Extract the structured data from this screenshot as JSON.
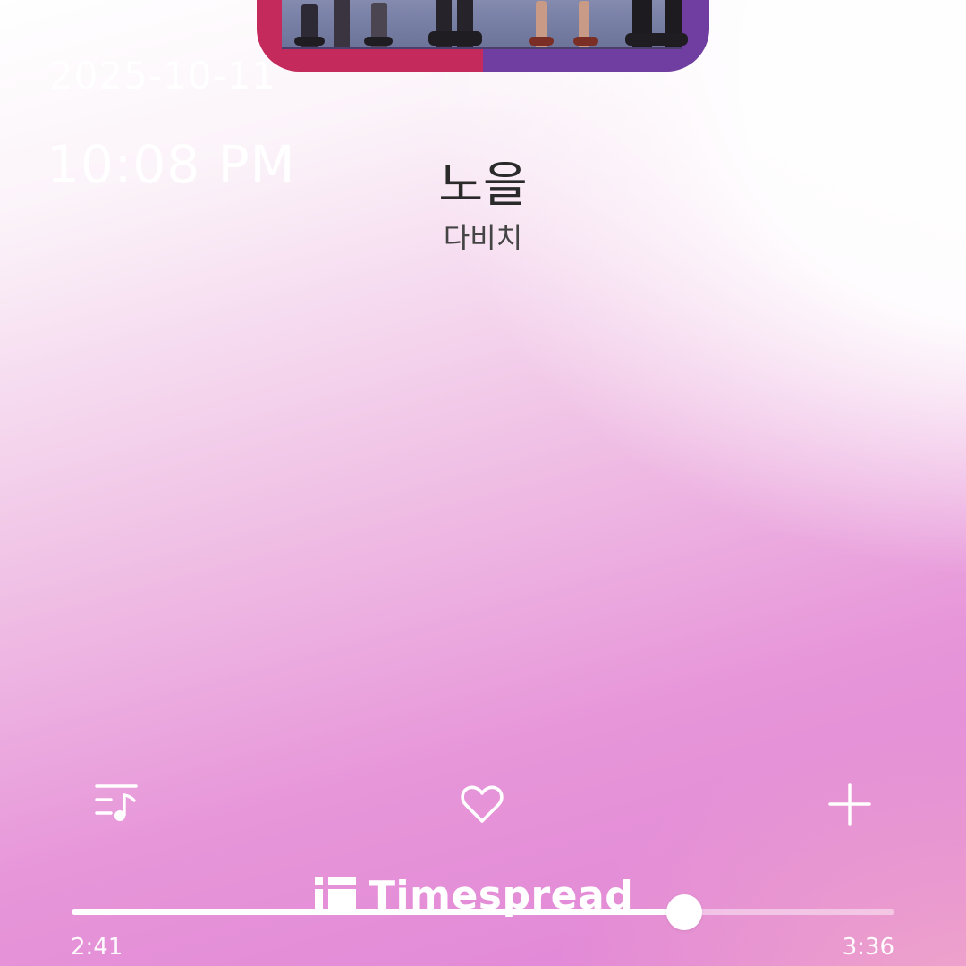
{
  "overlay": {
    "date": "2025-10-11",
    "time": "10:08 PM"
  },
  "track": {
    "title": "노을",
    "artist": "다비치"
  },
  "controls": {
    "playlist_icon": "playlist-music-icon",
    "like_icon": "heart-outline-icon",
    "add_icon": "plus-icon"
  },
  "watermark": {
    "text": "Timespread"
  },
  "playback": {
    "elapsed": "2:41",
    "total": "3:36",
    "progress": 0.745
  },
  "colors": {
    "album_left": "#c42a5c",
    "album_right": "#6f3ea0",
    "title_text": "#2a2a2a",
    "background_pink": "#e084d6"
  }
}
